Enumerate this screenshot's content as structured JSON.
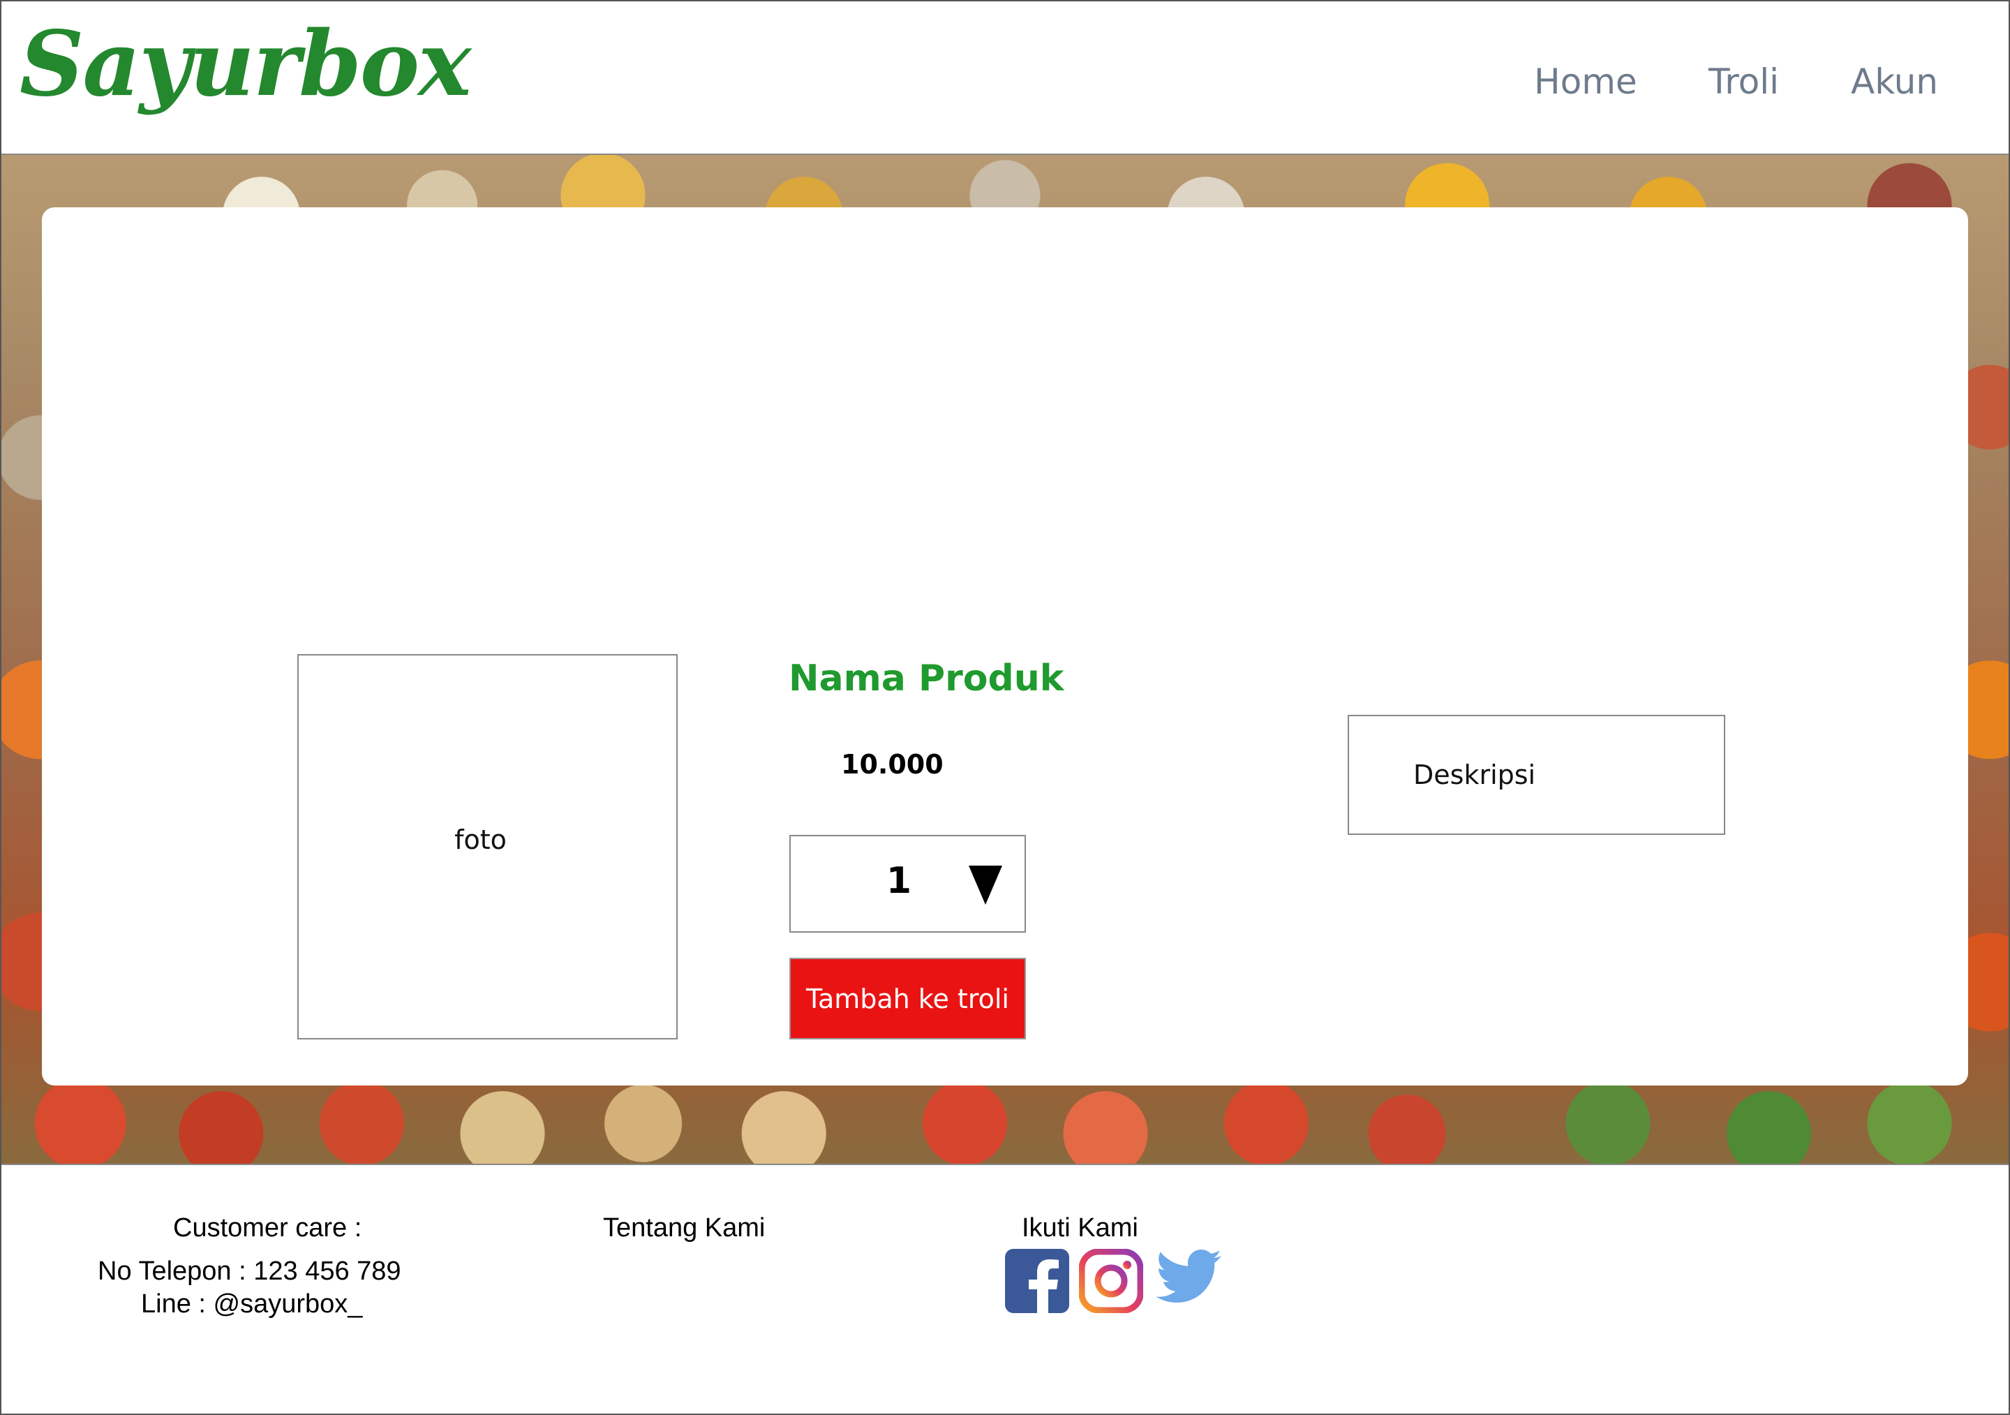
{
  "header": {
    "logo": "Sayurbox",
    "nav": [
      "Home",
      "Troli",
      "Akun"
    ]
  },
  "product": {
    "photo_label": "foto",
    "name": "Nama Produk",
    "price": "10.000",
    "quantity": "1",
    "add_button": "Tambah ke troli",
    "description_label": "Deskripsi"
  },
  "footer": {
    "customer_care_title": "Customer care :",
    "phone": "No Telepon : 123 456 789",
    "line": "Line : @sayurbox_",
    "about": "Tentang Kami",
    "follow": "Ikuti Kami",
    "social_icons": [
      "facebook-icon",
      "instagram-icon",
      "twitter-icon"
    ]
  },
  "colors": {
    "brand_green": "#23882e",
    "product_name_green": "#1f9a2e",
    "nav_gray": "#6e7b8c",
    "button_red": "#ea1313",
    "facebook_blue": "#3b5998",
    "twitter_blue": "#6ea9ea"
  }
}
